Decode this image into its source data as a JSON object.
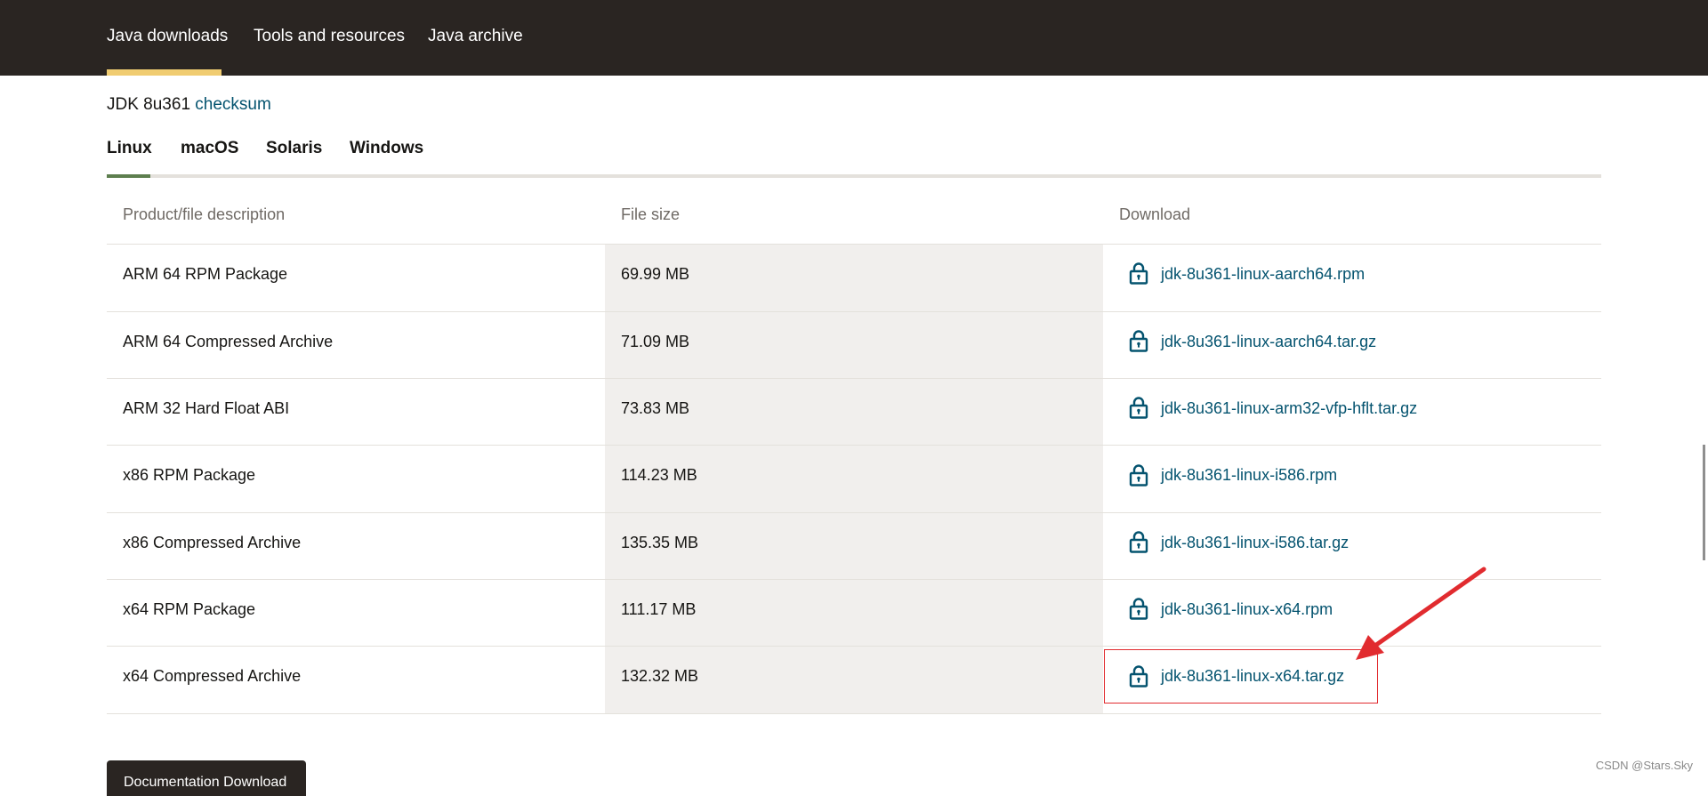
{
  "topnav": {
    "items": [
      "Java downloads",
      "Tools and resources",
      "Java archive"
    ]
  },
  "release": {
    "label": "JDK 8u361",
    "checksum_link": "checksum"
  },
  "os_tabs": [
    "Linux",
    "macOS",
    "Solaris",
    "Windows"
  ],
  "table": {
    "headers": [
      "Product/file description",
      "File size",
      "Download"
    ],
    "rows": [
      {
        "description": "ARM 64 RPM Package",
        "size": "69.99 MB",
        "file": "jdk-8u361-linux-aarch64.rpm"
      },
      {
        "description": "ARM 64 Compressed Archive",
        "size": "71.09 MB",
        "file": "jdk-8u361-linux-aarch64.tar.gz"
      },
      {
        "description": "ARM 32 Hard Float ABI",
        "size": "73.83 MB",
        "file": "jdk-8u361-linux-arm32-vfp-hflt.tar.gz"
      },
      {
        "description": "x86 RPM Package",
        "size": "114.23 MB",
        "file": "jdk-8u361-linux-i586.rpm"
      },
      {
        "description": "x86 Compressed Archive",
        "size": "135.35 MB",
        "file": "jdk-8u361-linux-i586.tar.gz"
      },
      {
        "description": "x64 RPM Package",
        "size": "111.17 MB",
        "file": "jdk-8u361-linux-x64.rpm"
      },
      {
        "description": "x64 Compressed Archive",
        "size": "132.32 MB",
        "file": "jdk-8u361-linux-x64.tar.gz"
      }
    ]
  },
  "doc_button": {
    "label": "Documentation Download"
  },
  "watermark": "CSDN @Stars.Sky",
  "icons": {
    "download": "lock-icon",
    "annotation": "red-arrow-icon"
  },
  "colors": {
    "nav_bg": "#2a2522",
    "nav_active": "#f0cc71",
    "link": "#04536f",
    "tab_active": "#5d7e4e",
    "shade": "#f1efed",
    "highlight": "#e12b2f"
  }
}
